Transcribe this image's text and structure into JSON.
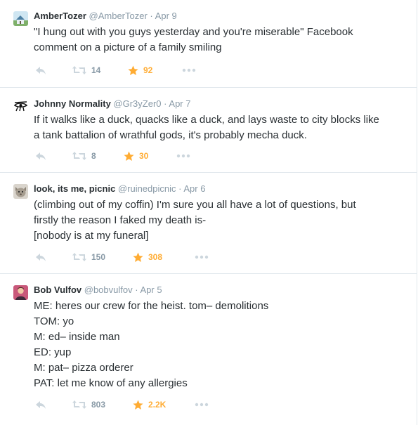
{
  "colors": {
    "text": "#292f33",
    "muted": "#8899a6",
    "favorite": "#ffac33",
    "action_icon": "#ccd6dd",
    "divider": "#e1e8ed"
  },
  "tweets": [
    {
      "name": "AmberTozer",
      "handle": "@AmberTozer",
      "separator": "·",
      "date": "Apr 9",
      "text": "\"I hung out with you guys yesterday and you're miserable\"  Facebook\ncomment on a picture of a family smiling",
      "retweets": "14",
      "favorites": "92",
      "avatar_icon": "house-photo-icon"
    },
    {
      "name": "Johnny Normality",
      "handle": "@Gr3yZer0",
      "separator": "·",
      "date": "Apr 7",
      "text": "If it walks like a duck, quacks like a duck, and lays waste to city blocks like\na tank battalion of wrathful gods, it's probably mecha duck.",
      "retweets": "8",
      "favorites": "30",
      "avatar_icon": "eye-glyph-icon"
    },
    {
      "name": "look, its me, picnic",
      "handle": "@ruinedpicnic",
      "separator": "·",
      "date": "Apr 6",
      "text": "(climbing out of my coffin) I'm sure you all have a lot of questions, but\nfirstly the reason I faked my death is-\n[nobody is at my funeral]",
      "retweets": "150",
      "favorites": "308",
      "avatar_icon": "cat-face-icon"
    },
    {
      "name": "Bob Vulfov",
      "handle": "@bobvulfov",
      "separator": "·",
      "date": "Apr 5",
      "text": "ME: heres our crew for the heist. tom– demolitions\nTOM: yo\nM: ed– inside man\nED: yup\nM: pat– pizza orderer\nPAT: let me know of any allergies",
      "retweets": "803",
      "favorites": "2.2K",
      "avatar_icon": "person-photo-icon"
    }
  ]
}
